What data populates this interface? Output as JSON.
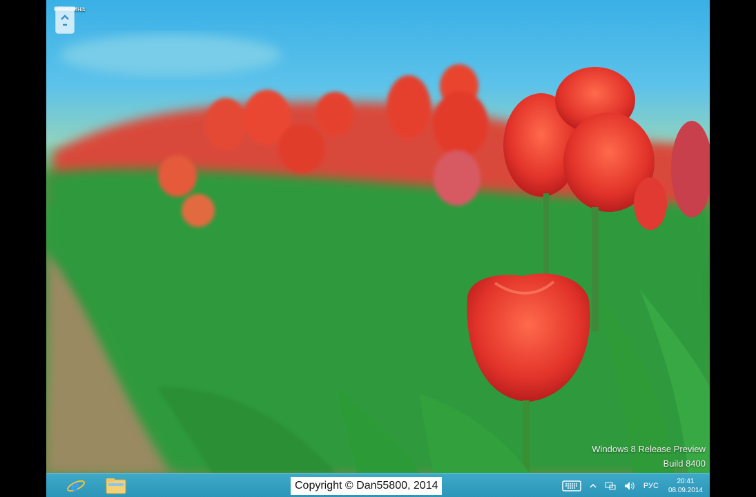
{
  "desktop": {
    "icons": [
      {
        "label": "Корзина",
        "icon": "recycle-bin-icon"
      }
    ],
    "watermark": {
      "line1": "Windows 8 Release Preview",
      "line2": "Build 8400"
    }
  },
  "taskbar": {
    "pinned": [
      {
        "name": "internet-explorer",
        "icon": "internet-explorer-icon"
      },
      {
        "name": "file-explorer",
        "icon": "folder-icon"
      }
    ],
    "overlay_text": "Copyright © Dan55800, 2014",
    "tray": {
      "keyboard_icon": "touch-keyboard-icon",
      "show_hidden_icon": "chevron-up-icon",
      "network_icon": "network-icon",
      "volume_icon": "speaker-icon",
      "language": "РУС",
      "time": "20:41",
      "date": "08.09.2014"
    }
  },
  "colors": {
    "taskbar": "#2c95b8",
    "sky": "#3ab0e6",
    "tulip": "#e8372a",
    "leaf": "#2f8f3a"
  }
}
